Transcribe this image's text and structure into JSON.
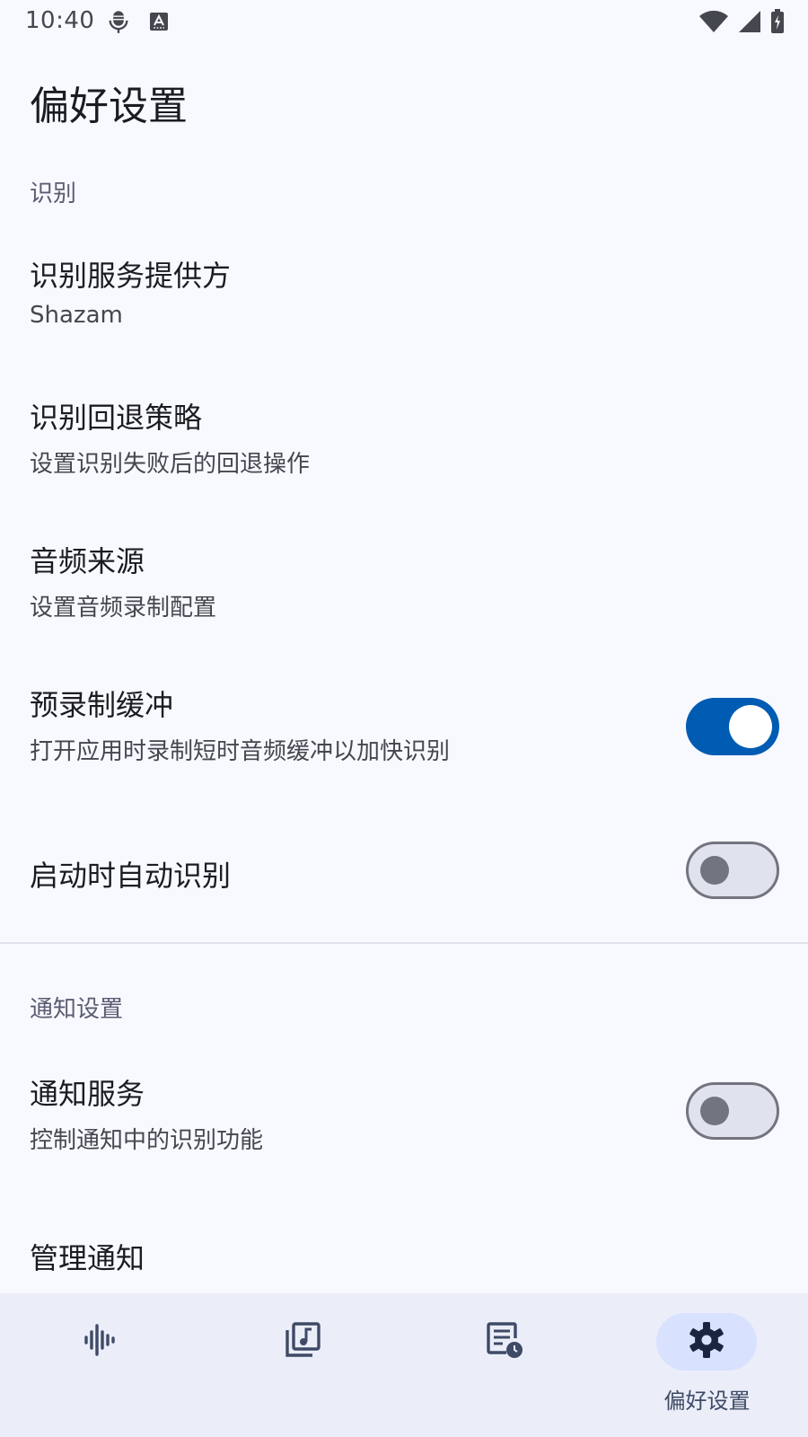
{
  "status_bar": {
    "time": "10:40"
  },
  "header": {
    "title": "偏好设置"
  },
  "sections": {
    "recognition": {
      "header": "识别",
      "provider": {
        "title": "识别服务提供方",
        "summary": "Shazam"
      },
      "fallback": {
        "title": "识别回退策略",
        "summary": "设置识别失败后的回退操作"
      },
      "audio_source": {
        "title": "音频来源",
        "summary": "设置音频录制配置"
      },
      "prerecord": {
        "title": "预录制缓冲",
        "summary": "打开应用时录制短时音频缓冲以加快识别",
        "checked": true
      },
      "auto_recognize": {
        "title": "启动时自动识别",
        "checked": false
      }
    },
    "notifications": {
      "header": "通知设置",
      "service": {
        "title": "通知服务",
        "summary": "控制通知中的识别功能",
        "checked": false
      },
      "manage": {
        "title": "管理通知"
      }
    }
  },
  "bottom_nav": {
    "items": [
      {
        "icon": "waveform-icon",
        "label": ""
      },
      {
        "icon": "music-library-icon",
        "label": ""
      },
      {
        "icon": "history-list-icon",
        "label": ""
      },
      {
        "icon": "gear-icon",
        "label": "偏好设置",
        "active": true
      }
    ]
  },
  "colors": {
    "background": "#f8f9ff",
    "accent": "#005cb3",
    "section_header": "#5a5d72",
    "nav_background": "#ebeef9",
    "nav_active_pill": "#d8e2ff"
  }
}
